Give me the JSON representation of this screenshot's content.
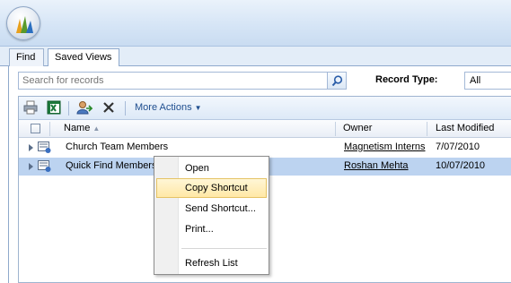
{
  "tabs": [
    {
      "label": "Find"
    },
    {
      "label": "Saved Views"
    }
  ],
  "search": {
    "placeholder": "Search for records"
  },
  "record_type": {
    "label": "Record Type:",
    "value": "All"
  },
  "toolbar": {
    "more_actions": "More Actions"
  },
  "columns": {
    "name": "Name",
    "owner": "Owner",
    "last_modified": "Last Modified"
  },
  "rows": [
    {
      "name": "Church Team Members",
      "owner": "Magnetism Interns",
      "last_modified": "7/07/2010"
    },
    {
      "name": "Quick Find Members",
      "owner": "Roshan Mehta",
      "last_modified": "10/07/2010"
    }
  ],
  "context_menu": {
    "items": [
      {
        "label": "Open"
      },
      {
        "label": "Copy Shortcut"
      },
      {
        "label": "Send Shortcut..."
      },
      {
        "label": "Print..."
      },
      {
        "label": "Refresh List"
      }
    ]
  },
  "colors": {
    "accent": "#1f4e8f",
    "selected_row": "#bcd3f0",
    "menu_highlight": "#ffe8a6"
  }
}
